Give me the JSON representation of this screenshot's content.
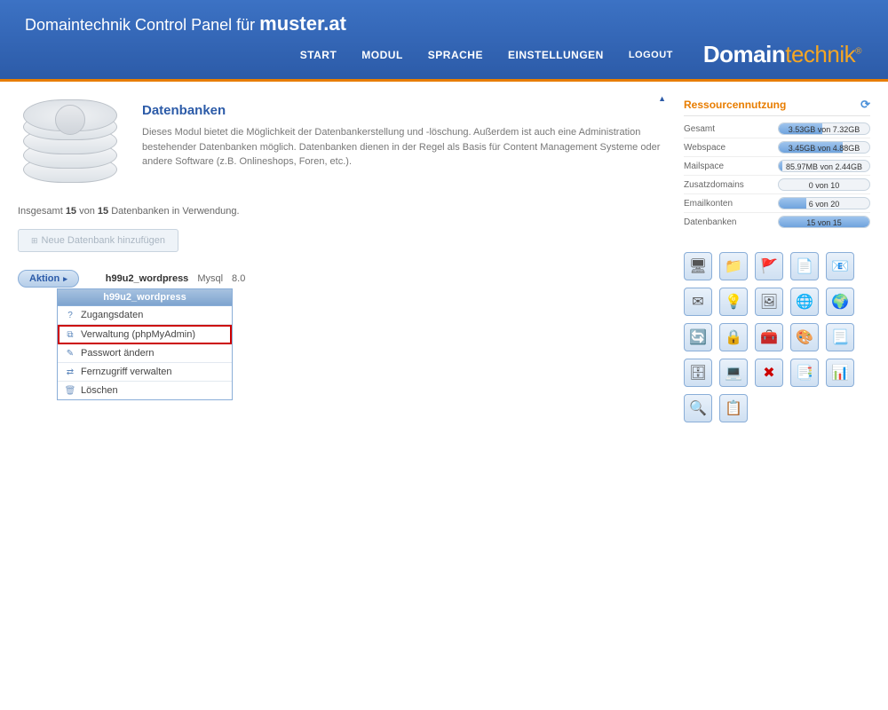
{
  "header": {
    "title_prefix": "Domaintechnik Control Panel für ",
    "domain": "muster.at",
    "nav": {
      "start": "START",
      "modul": "MODUL",
      "sprache": "SPRACHE",
      "einstellungen": "EINSTELLUNGEN",
      "logout": "LOGOUT"
    },
    "brand": {
      "p1": "Domain",
      "p2": "technik",
      "r": "®"
    }
  },
  "module": {
    "heading": "Datenbanken",
    "description": "Dieses Modul bietet die Möglichkeit der Datenbankerstellung und -löschung. Außerdem ist auch eine Administration bestehender Datenbanken möglich. Datenbanken dienen in der Regel als Basis für Content Management Systeme oder andere Software (z.B. Onlineshops, Foren, etc.)."
  },
  "usage_summary": {
    "prefix": "Insgesamt ",
    "used": "15",
    "mid": " von ",
    "total": "15",
    "suffix": " Datenbanken in Verwendung."
  },
  "buttons": {
    "add_db": "Neue Datenbank hinzufügen",
    "aktion": "Aktion"
  },
  "db_entry": {
    "name": "h99u2_wordpress",
    "type": "Mysql",
    "version": "8.0"
  },
  "dropdown": {
    "title": "h99u2_wordpress",
    "items": {
      "creds": "Zugangsdaten",
      "admin": "Verwaltung (phpMyAdmin)",
      "pwd": "Passwort ändern",
      "remote": "Fernzugriff verwalten",
      "delete": "Löschen"
    }
  },
  "resources": {
    "heading": "Ressourcennutzung",
    "rows": {
      "gesamt": {
        "label": "Gesamt",
        "text": "3.53GB von 7.32GB",
        "pct": 48
      },
      "webspace": {
        "label": "Webspace",
        "text": "3.45GB von 4.88GB",
        "pct": 71
      },
      "mailspace": {
        "label": "Mailspace",
        "text": "85.97MB von 2.44GB",
        "pct": 4
      },
      "zusatzdomains": {
        "label": "Zusatzdomains",
        "text": "0 von 10",
        "pct": 0
      },
      "emailkonten": {
        "label": "Emailkonten",
        "text": "6 von 20",
        "pct": 30
      },
      "datenbanken": {
        "label": "Datenbanken",
        "text": "15 von 15",
        "pct": 100
      }
    }
  },
  "icon_grid": [
    "server-icon",
    "folder-icon",
    "flag-icon",
    "file-icon",
    "mail-icon",
    "envelope-icon",
    "bulb-icon",
    "picture-icon",
    "globe-mail-icon",
    "world-icon",
    "refresh-icon",
    "lock-icon",
    "toolbox-icon",
    "palette-icon",
    "document-icon",
    "database-icon",
    "monitor-icon",
    "delete-icon",
    "page-icon",
    "chart-icon",
    "search-icon",
    "note-icon"
  ],
  "glyphs": {
    "server-icon": "🖥",
    "folder-icon": "📁",
    "flag-icon": "🚩",
    "file-icon": "📄",
    "mail-icon": "📧",
    "envelope-icon": "✉",
    "bulb-icon": "💡",
    "picture-icon": "🖼",
    "globe-mail-icon": "🌐",
    "world-icon": "🌍",
    "refresh-icon": "🔄",
    "lock-icon": "🔒",
    "toolbox-icon": "🧰",
    "palette-icon": "🎨",
    "document-icon": "📃",
    "database-icon": "🗄",
    "monitor-icon": "💻",
    "delete-icon": "✖",
    "page-icon": "📑",
    "chart-icon": "📊",
    "search-icon": "🔍",
    "note-icon": "📋"
  }
}
